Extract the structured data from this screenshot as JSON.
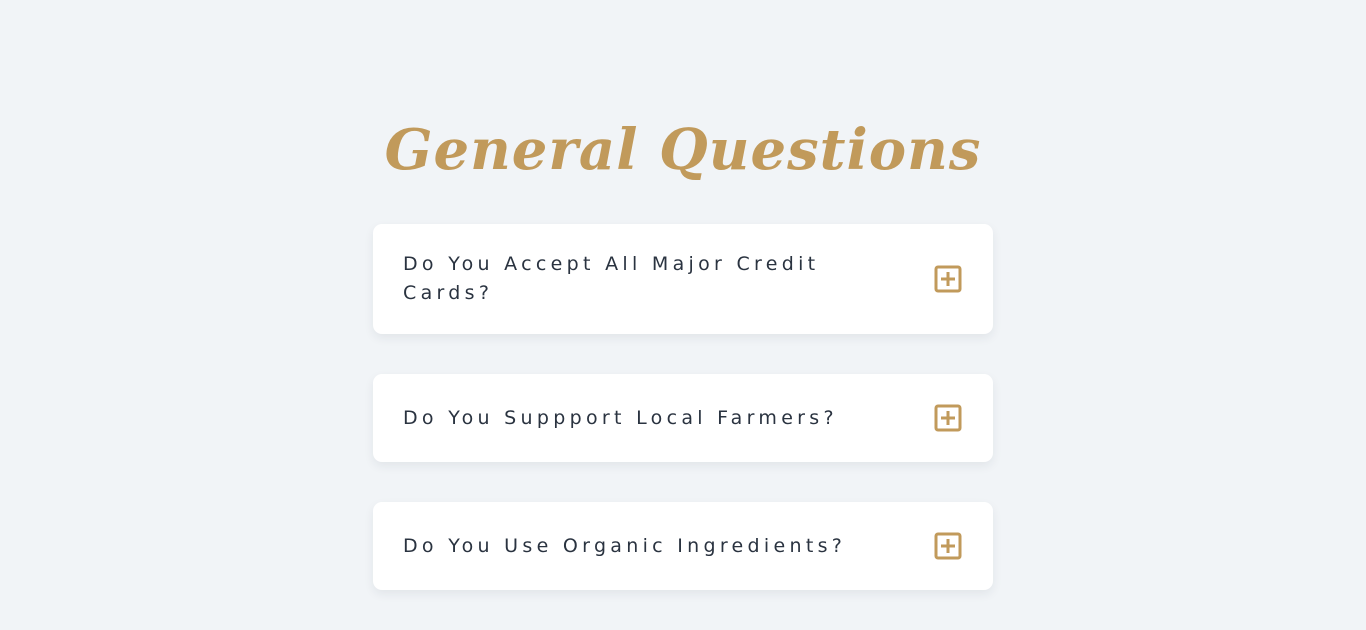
{
  "section": {
    "title": "General Questions"
  },
  "faq": {
    "items": [
      {
        "question": "Do You Accept All Major Credit Cards?",
        "expanded": false
      },
      {
        "question": "Do You Suppport Local Farmers?",
        "expanded": false
      },
      {
        "question": "Do You Use Organic Ingredients?",
        "expanded": false
      }
    ],
    "toggle_icon": "plus-square-icon"
  },
  "colors": {
    "background": "#f1f4f7",
    "accent": "#c19a5b",
    "card": "#ffffff",
    "text": "#2a3340"
  }
}
